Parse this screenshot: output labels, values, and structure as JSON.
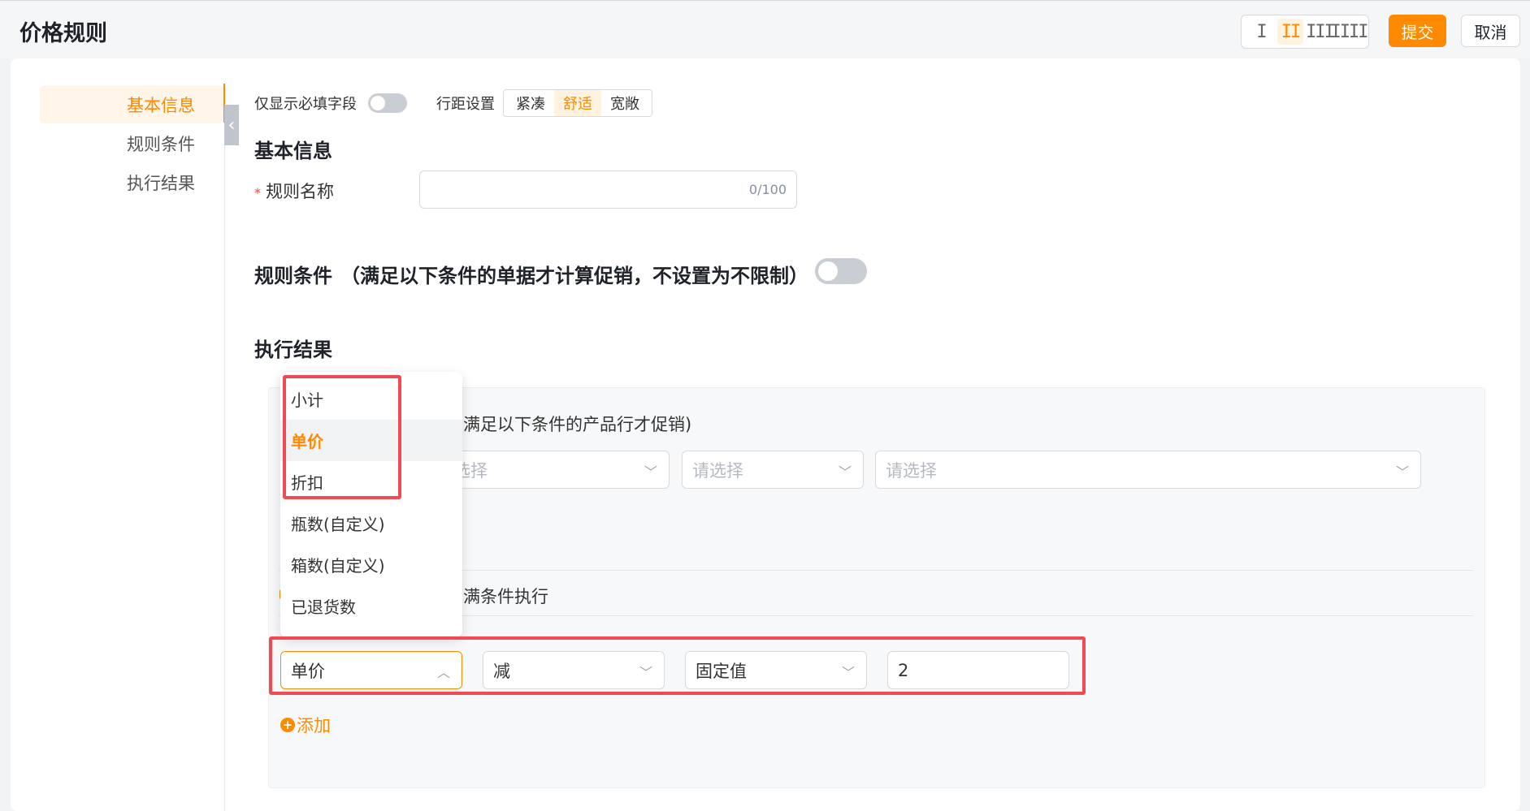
{
  "header": {
    "title": "价格规则",
    "density_options": [
      "I",
      "II",
      "III",
      "IIII"
    ],
    "submit_label": "提交",
    "cancel_label": "取消"
  },
  "sidebar": {
    "items": [
      {
        "label": "基本信息",
        "active": true
      },
      {
        "label": "规则条件",
        "active": false
      },
      {
        "label": "执行结果",
        "active": false
      }
    ]
  },
  "toolbar": {
    "required_only_label": "仅显示必填字段",
    "required_only_on": false,
    "spacing_label": "行距设置",
    "spacing_options": [
      "紧凑",
      "舒适",
      "宽敞"
    ],
    "spacing_selected": "舒适"
  },
  "basic_info": {
    "title": "基本信息",
    "rule_name_label": "规则名称",
    "rule_name_value": "",
    "rule_name_counter": "0/100"
  },
  "rule_conditions": {
    "title": "规则条件",
    "hint": "（满足以下条件的单据才计算促销，不设置为不限制）",
    "enabled": false
  },
  "execution_result": {
    "title": "执行结果",
    "product_condition_text": "满足以下条件的产品行才促销)",
    "condition_selects": [
      {
        "placeholder": "选择"
      },
      {
        "placeholder": "请选择"
      },
      {
        "placeholder": "请选择"
      }
    ],
    "execute_text": "满条件执行",
    "action_row": {
      "field": "单价",
      "operator": "减",
      "value_type": "固定值",
      "value": "2"
    },
    "add_label": "添加"
  },
  "dropdown": {
    "options": [
      "小计",
      "单价",
      "折扣",
      "瓶数(自定义)",
      "箱数(自定义)",
      "已退货数"
    ],
    "selected": "单价"
  },
  "colors": {
    "accent": "#ff8a00",
    "highlight": "#f04b55"
  }
}
